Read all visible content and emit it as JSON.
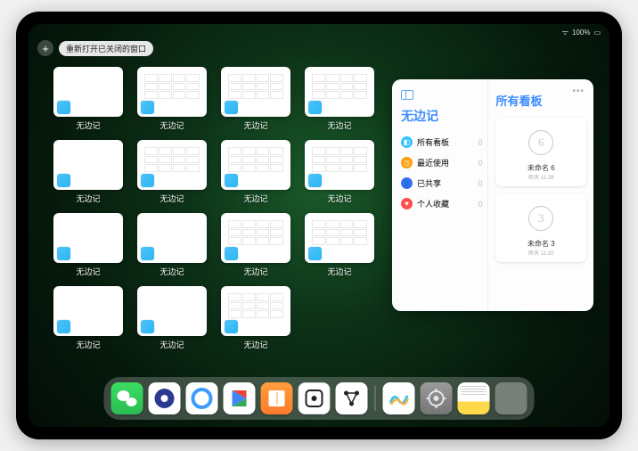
{
  "status": {
    "wifi": "􀙇",
    "battery": "100%"
  },
  "topbar": {
    "close_glyph": "+",
    "reopen_label": "重新打开已关闭的窗口"
  },
  "tile_label": "无边记",
  "tiles": [
    {
      "variant": "blank"
    },
    {
      "variant": "grid"
    },
    {
      "variant": "grid"
    },
    {
      "variant": "grid"
    },
    {
      "variant": "blank"
    },
    {
      "variant": "grid"
    },
    {
      "variant": "grid"
    },
    {
      "variant": "grid"
    },
    {
      "variant": "blank"
    },
    {
      "variant": "blank"
    },
    {
      "variant": "grid"
    },
    {
      "variant": "grid"
    },
    {
      "variant": "blank"
    },
    {
      "variant": "blank"
    },
    {
      "variant": "grid"
    }
  ],
  "panel": {
    "left_title": "无边记",
    "categories": [
      {
        "icon_color": "#34c2ff",
        "glyph": "◧",
        "label": "所有看板",
        "count": "0"
      },
      {
        "icon_color": "#ff9e0a",
        "glyph": "◷",
        "label": "最近使用",
        "count": "0"
      },
      {
        "icon_color": "#3d6bff",
        "glyph": "👤",
        "label": "已共享",
        "count": "0"
      },
      {
        "icon_color": "#ff4d4d",
        "glyph": "♥",
        "label": "个人收藏",
        "count": "0"
      }
    ],
    "right_title": "所有看板",
    "boards": [
      {
        "sketch": "6",
        "name": "未命名 6",
        "sub": "昨天 11:28"
      },
      {
        "sketch": "3",
        "name": "未命名 3",
        "sub": "昨天 11:20"
      }
    ],
    "handle": "•••"
  },
  "dock": {
    "apps": [
      {
        "id": "wechat",
        "class": "di-wechat"
      },
      {
        "id": "quark",
        "class": "di-quark"
      },
      {
        "id": "qq-browser",
        "class": "di-qqb"
      },
      {
        "id": "google-play",
        "class": "di-play"
      },
      {
        "id": "books",
        "class": "di-books"
      },
      {
        "id": "dice",
        "class": "di-dice"
      },
      {
        "id": "nodes",
        "class": "di-nodes"
      }
    ],
    "recent": [
      {
        "id": "freeform",
        "class": "di-freeform"
      },
      {
        "id": "settings",
        "class": "di-settings"
      },
      {
        "id": "notes",
        "class": "di-notes"
      },
      {
        "id": "app-library",
        "class": "di-library"
      }
    ]
  }
}
